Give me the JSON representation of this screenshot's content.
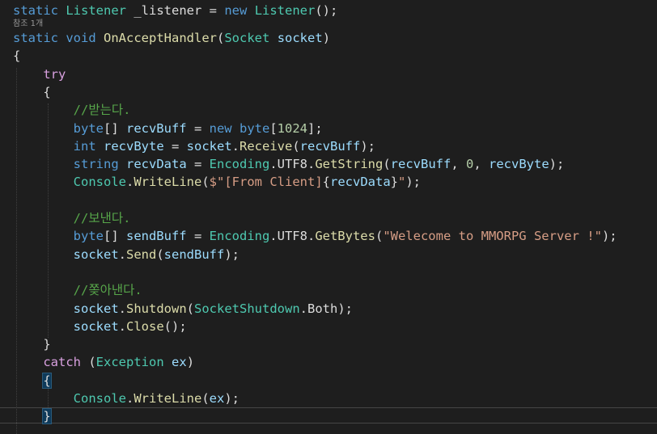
{
  "editor": {
    "codelens": "참조 1개",
    "lines": [
      [
        {
          "t": "static",
          "c": "kw"
        },
        {
          "t": " ",
          "c": "plain"
        },
        {
          "t": "Listener",
          "c": "type"
        },
        {
          "t": " ",
          "c": "plain"
        },
        {
          "t": "_listener",
          "c": "plain"
        },
        {
          "t": " = ",
          "c": "plain"
        },
        {
          "t": "new",
          "c": "kw"
        },
        {
          "t": " ",
          "c": "plain"
        },
        {
          "t": "Listener",
          "c": "type"
        },
        {
          "t": "();",
          "c": "plain"
        }
      ],
      [
        {
          "t": "static",
          "c": "kw"
        },
        {
          "t": " ",
          "c": "plain"
        },
        {
          "t": "void",
          "c": "kw"
        },
        {
          "t": " ",
          "c": "plain"
        },
        {
          "t": "OnAcceptHandler",
          "c": "method"
        },
        {
          "t": "(",
          "c": "plain"
        },
        {
          "t": "Socket",
          "c": "type"
        },
        {
          "t": " ",
          "c": "plain"
        },
        {
          "t": "socket",
          "c": "var"
        },
        {
          "t": ")",
          "c": "plain"
        }
      ],
      [
        {
          "t": "{",
          "c": "plain"
        }
      ],
      [
        {
          "t": "    ",
          "c": "plain"
        },
        {
          "t": "try",
          "c": "ctl"
        }
      ],
      [
        {
          "t": "    {",
          "c": "plain"
        }
      ],
      [
        {
          "t": "        ",
          "c": "plain"
        },
        {
          "t": "//받는다.",
          "c": "cmt"
        }
      ],
      [
        {
          "t": "        ",
          "c": "plain"
        },
        {
          "t": "byte",
          "c": "kw"
        },
        {
          "t": "[] ",
          "c": "plain"
        },
        {
          "t": "recvBuff",
          "c": "var"
        },
        {
          "t": " = ",
          "c": "plain"
        },
        {
          "t": "new",
          "c": "kw"
        },
        {
          "t": " ",
          "c": "plain"
        },
        {
          "t": "byte",
          "c": "kw"
        },
        {
          "t": "[",
          "c": "plain"
        },
        {
          "t": "1024",
          "c": "num"
        },
        {
          "t": "];",
          "c": "plain"
        }
      ],
      [
        {
          "t": "        ",
          "c": "plain"
        },
        {
          "t": "int",
          "c": "kw"
        },
        {
          "t": " ",
          "c": "plain"
        },
        {
          "t": "recvByte",
          "c": "var"
        },
        {
          "t": " = ",
          "c": "plain"
        },
        {
          "t": "socket",
          "c": "var"
        },
        {
          "t": ".",
          "c": "plain"
        },
        {
          "t": "Receive",
          "c": "method"
        },
        {
          "t": "(",
          "c": "plain"
        },
        {
          "t": "recvBuff",
          "c": "var"
        },
        {
          "t": ");",
          "c": "plain"
        }
      ],
      [
        {
          "t": "        ",
          "c": "plain"
        },
        {
          "t": "string",
          "c": "kw"
        },
        {
          "t": " ",
          "c": "plain"
        },
        {
          "t": "recvData",
          "c": "var"
        },
        {
          "t": " = ",
          "c": "plain"
        },
        {
          "t": "Encoding",
          "c": "type"
        },
        {
          "t": ".",
          "c": "plain"
        },
        {
          "t": "UTF8",
          "c": "plain"
        },
        {
          "t": ".",
          "c": "plain"
        },
        {
          "t": "GetString",
          "c": "method"
        },
        {
          "t": "(",
          "c": "plain"
        },
        {
          "t": "recvBuff",
          "c": "var"
        },
        {
          "t": ", ",
          "c": "plain"
        },
        {
          "t": "0",
          "c": "num"
        },
        {
          "t": ", ",
          "c": "plain"
        },
        {
          "t": "recvByte",
          "c": "var"
        },
        {
          "t": ");",
          "c": "plain"
        }
      ],
      [
        {
          "t": "        ",
          "c": "plain"
        },
        {
          "t": "Console",
          "c": "type"
        },
        {
          "t": ".",
          "c": "plain"
        },
        {
          "t": "WriteLine",
          "c": "method"
        },
        {
          "t": "(",
          "c": "plain"
        },
        {
          "t": "$\"[From Client]",
          "c": "str"
        },
        {
          "t": "{",
          "c": "plain"
        },
        {
          "t": "recvData",
          "c": "var"
        },
        {
          "t": "}",
          "c": "plain"
        },
        {
          "t": "\"",
          "c": "str"
        },
        {
          "t": ");",
          "c": "plain"
        }
      ],
      [],
      [
        {
          "t": "        ",
          "c": "plain"
        },
        {
          "t": "//보낸다.",
          "c": "cmt"
        }
      ],
      [
        {
          "t": "        ",
          "c": "plain"
        },
        {
          "t": "byte",
          "c": "kw"
        },
        {
          "t": "[] ",
          "c": "plain"
        },
        {
          "t": "sendBuff",
          "c": "var"
        },
        {
          "t": " = ",
          "c": "plain"
        },
        {
          "t": "Encoding",
          "c": "type"
        },
        {
          "t": ".",
          "c": "plain"
        },
        {
          "t": "UTF8",
          "c": "plain"
        },
        {
          "t": ".",
          "c": "plain"
        },
        {
          "t": "GetBytes",
          "c": "method"
        },
        {
          "t": "(",
          "c": "plain"
        },
        {
          "t": "\"Welecome to MMORPG Server !\"",
          "c": "str"
        },
        {
          "t": ");",
          "c": "plain"
        }
      ],
      [
        {
          "t": "        ",
          "c": "plain"
        },
        {
          "t": "socket",
          "c": "var"
        },
        {
          "t": ".",
          "c": "plain"
        },
        {
          "t": "Send",
          "c": "method"
        },
        {
          "t": "(",
          "c": "plain"
        },
        {
          "t": "sendBuff",
          "c": "var"
        },
        {
          "t": ");",
          "c": "plain"
        }
      ],
      [],
      [
        {
          "t": "        ",
          "c": "plain"
        },
        {
          "t": "//쫒아낸다.",
          "c": "cmt"
        }
      ],
      [
        {
          "t": "        ",
          "c": "plain"
        },
        {
          "t": "socket",
          "c": "var"
        },
        {
          "t": ".",
          "c": "plain"
        },
        {
          "t": "Shutdown",
          "c": "method"
        },
        {
          "t": "(",
          "c": "plain"
        },
        {
          "t": "SocketShutdown",
          "c": "type"
        },
        {
          "t": ".",
          "c": "plain"
        },
        {
          "t": "Both",
          "c": "plain"
        },
        {
          "t": ");",
          "c": "plain"
        }
      ],
      [
        {
          "t": "        ",
          "c": "plain"
        },
        {
          "t": "socket",
          "c": "var"
        },
        {
          "t": ".",
          "c": "plain"
        },
        {
          "t": "Close",
          "c": "method"
        },
        {
          "t": "();",
          "c": "plain"
        }
      ],
      [
        {
          "t": "    }",
          "c": "plain"
        }
      ],
      [
        {
          "t": "    ",
          "c": "plain"
        },
        {
          "t": "catch",
          "c": "ctl"
        },
        {
          "t": " (",
          "c": "plain"
        },
        {
          "t": "Exception",
          "c": "type"
        },
        {
          "t": " ",
          "c": "plain"
        },
        {
          "t": "ex",
          "c": "var"
        },
        {
          "t": ")",
          "c": "plain"
        }
      ],
      [
        {
          "t": "    ",
          "c": "plain"
        },
        {
          "t": "{",
          "c": "plain",
          "hl": true
        }
      ],
      [
        {
          "t": "        ",
          "c": "plain"
        },
        {
          "t": "Console",
          "c": "type"
        },
        {
          "t": ".",
          "c": "plain"
        },
        {
          "t": "WriteLine",
          "c": "method"
        },
        {
          "t": "(",
          "c": "plain"
        },
        {
          "t": "ex",
          "c": "var"
        },
        {
          "t": ");",
          "c": "plain"
        }
      ],
      [
        {
          "t": "    ",
          "c": "plain"
        },
        {
          "t": "}",
          "c": "plain",
          "hl": true
        }
      ]
    ]
  }
}
